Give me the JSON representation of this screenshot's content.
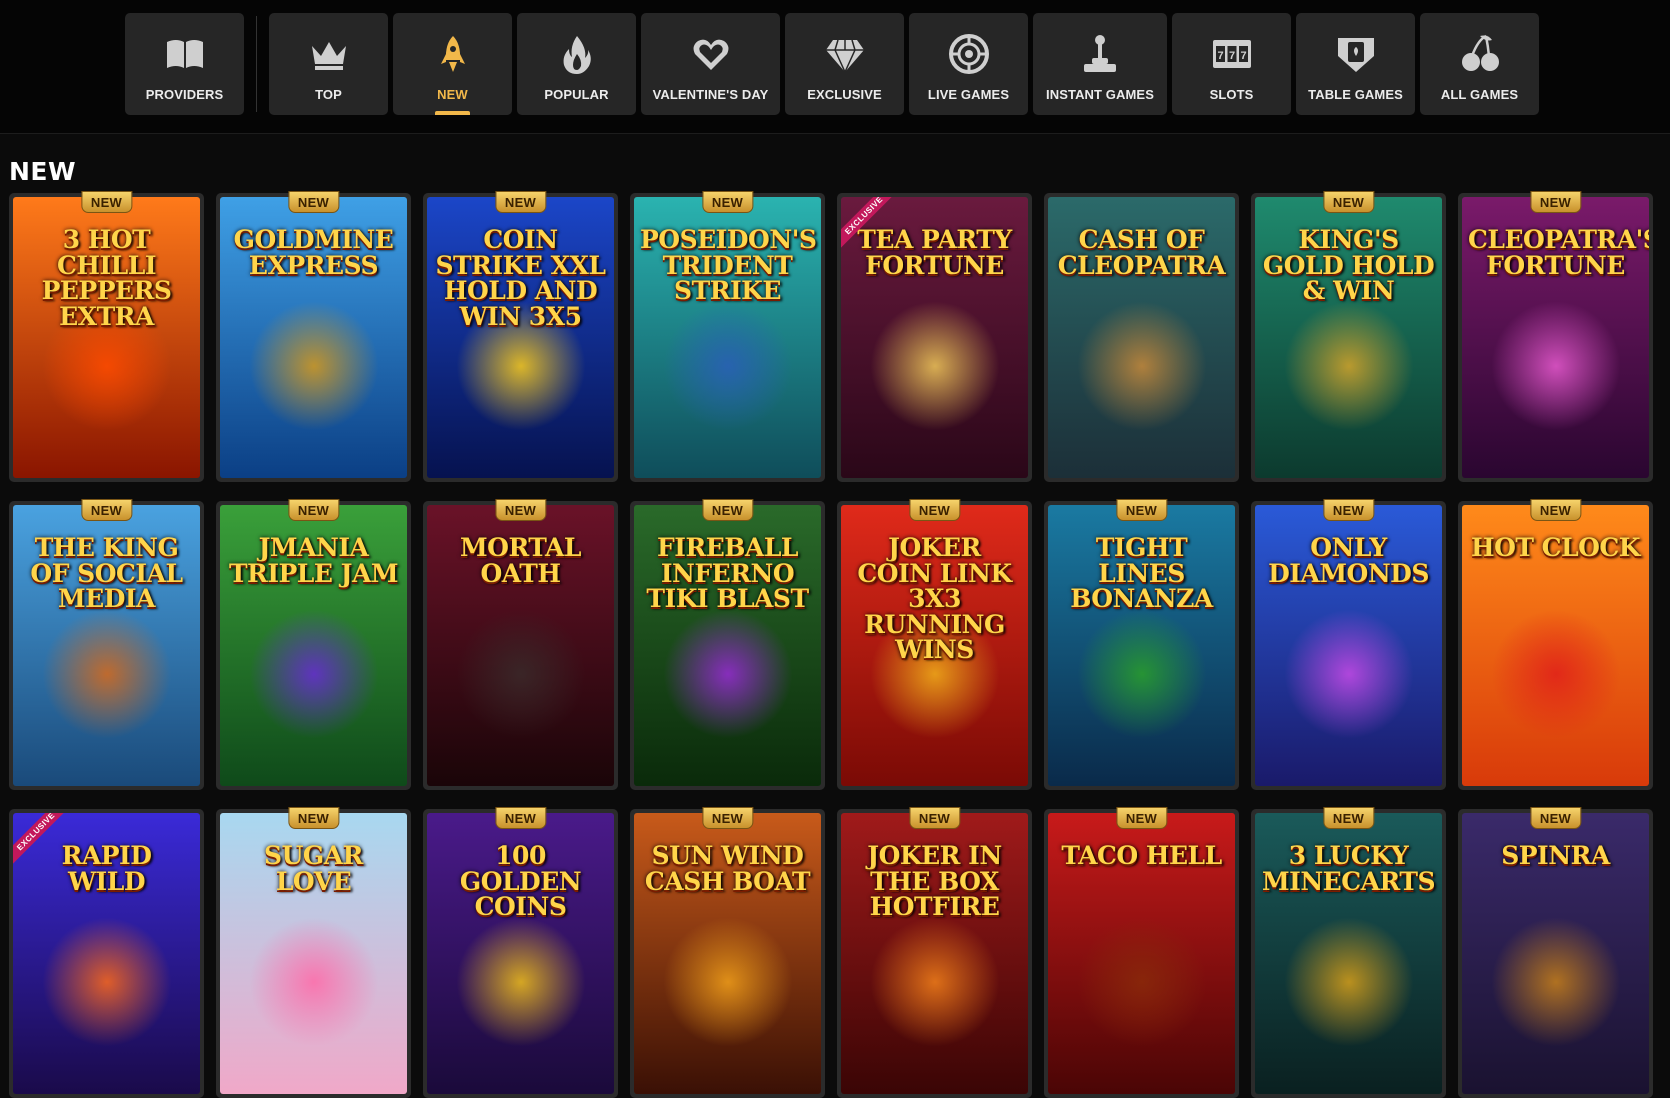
{
  "nav": {
    "items": [
      {
        "label": "PROVIDERS",
        "icon": "book-icon"
      },
      {
        "label": "TOP",
        "icon": "crown-icon"
      },
      {
        "label": "NEW",
        "icon": "rocket-icon",
        "active": true
      },
      {
        "label": "POPULAR",
        "icon": "fire-icon"
      },
      {
        "label": "VALENTINE'S DAY",
        "icon": "heart-icon"
      },
      {
        "label": "EXCLUSIVE",
        "icon": "diamond-icon"
      },
      {
        "label": "LIVE GAMES",
        "icon": "roulette-icon"
      },
      {
        "label": "INSTANT GAMES",
        "icon": "joystick-icon"
      },
      {
        "label": "SLOTS",
        "icon": "slot-machine-icon"
      },
      {
        "label": "TABLE GAMES",
        "icon": "card-table-icon"
      },
      {
        "label": "ALL GAMES",
        "icon": "cherries-icon"
      }
    ],
    "active_color": "#f2b84a"
  },
  "section": {
    "title": "NEW"
  },
  "badge_text": "NEW",
  "ribbon_text": "EXCLUSIVE",
  "games": [
    {
      "title": "3 HOT CHILLI PEPPERS EXTRA",
      "badge": true,
      "exclusive": false,
      "bg": [
        "#ff7a1a",
        "#8a1500"
      ],
      "glow": "#ff4b00"
    },
    {
      "title": "GOLDMINE EXPRESS",
      "badge": true,
      "exclusive": false,
      "bg": [
        "#3fa0e6",
        "#0b3f85"
      ],
      "glow": "#d89a1a"
    },
    {
      "title": "COIN STRIKE XXL HOLD AND WIN 3X5",
      "badge": true,
      "exclusive": false,
      "bg": [
        "#1b46c8",
        "#06124f"
      ],
      "glow": "#ffcf1a"
    },
    {
      "title": "POSEIDON'S TRIDENT STRIKE",
      "badge": true,
      "exclusive": false,
      "bg": [
        "#2ab3b0",
        "#0f4d5a"
      ],
      "glow": "#2a5fb8"
    },
    {
      "title": "TEA PARTY FORTUNE",
      "badge": false,
      "exclusive": true,
      "bg": [
        "#6a1a3e",
        "#2a0718"
      ],
      "glow": "#f2c95a"
    },
    {
      "title": "CASH OF CLEOPATRA",
      "badge": false,
      "exclusive": false,
      "bg": [
        "#2b6a6a",
        "#1c2f38"
      ],
      "glow": "#c88a3a"
    },
    {
      "title": "KING'S GOLD HOLD & WIN",
      "badge": true,
      "exclusive": false,
      "bg": [
        "#1f8a6e",
        "#0c3a2e"
      ],
      "glow": "#d6a52a"
    },
    {
      "title": "CLEOPATRA'S FORTUNE",
      "badge": true,
      "exclusive": false,
      "bg": [
        "#7a1a6a",
        "#2a0630"
      ],
      "glow": "#e85ad0"
    },
    {
      "title": "THE KING OF SOCIAL MEDIA",
      "badge": true,
      "exclusive": false,
      "bg": [
        "#4aa2e0",
        "#1a4a7a"
      ],
      "glow": "#d86a1a"
    },
    {
      "title": "JMANIA TRIPLE JAM",
      "badge": true,
      "exclusive": false,
      "bg": [
        "#3aa03a",
        "#0f4a1a"
      ],
      "glow": "#6a2ad8"
    },
    {
      "title": "MORTAL OATH",
      "badge": true,
      "exclusive": false,
      "bg": [
        "#6a1228",
        "#1a0508"
      ],
      "glow": "#3a2a2a"
    },
    {
      "title": "FIREBALL INFERNO TIKI BLAST",
      "badge": true,
      "exclusive": false,
      "bg": [
        "#2a6a2a",
        "#0a2a0a"
      ],
      "glow": "#9a2ad8"
    },
    {
      "title": "JOKER COIN LINK 3X3 RUNNING WINS",
      "badge": true,
      "exclusive": false,
      "bg": [
        "#e02a1a",
        "#7a0a05"
      ],
      "glow": "#f2b01a"
    },
    {
      "title": "TIGHT LINES BONANZA",
      "badge": true,
      "exclusive": false,
      "bg": [
        "#1a7aa2",
        "#0a2a4a"
      ],
      "glow": "#2aa02a"
    },
    {
      "title": "ONLY DIAMONDS",
      "badge": true,
      "exclusive": false,
      "bg": [
        "#2a5ad8",
        "#1a1a6a"
      ],
      "glow": "#c84ae8"
    },
    {
      "title": "HOT CLOCK",
      "badge": true,
      "exclusive": false,
      "bg": [
        "#ff8a1a",
        "#d83a0a"
      ],
      "glow": "#e0201a"
    },
    {
      "title": "RAPID WILD",
      "badge": false,
      "exclusive": true,
      "bg": [
        "#3a2ad8",
        "#1a0a4a"
      ],
      "glow": "#ff6a1a"
    },
    {
      "title": "SUGAR LOVE",
      "badge": true,
      "exclusive": false,
      "bg": [
        "#a8d8f0",
        "#f0a8c8"
      ],
      "glow": "#ff6aa8"
    },
    {
      "title": "100 GOLDEN COINS",
      "badge": true,
      "exclusive": false,
      "bg": [
        "#4a1a8a",
        "#1a0a3a"
      ],
      "glow": "#f2c01a"
    },
    {
      "title": "SUN WIND CASH BOAT",
      "badge": true,
      "exclusive": false,
      "bg": [
        "#c85a1a",
        "#3a1005"
      ],
      "glow": "#f2a01a"
    },
    {
      "title": "JOKER IN THE BOX HOTFIRE",
      "badge": true,
      "exclusive": false,
      "bg": [
        "#a01a1a",
        "#3a0505"
      ],
      "glow": "#f2801a"
    },
    {
      "title": "TACO HELL",
      "badge": true,
      "exclusive": false,
      "bg": [
        "#c81a1a",
        "#4a0505"
      ],
      "glow": "#8a2a0a"
    },
    {
      "title": "3 LUCKY MINECARTS",
      "badge": true,
      "exclusive": false,
      "bg": [
        "#1a5a5a",
        "#0a2020"
      ],
      "glow": "#d8a01a"
    },
    {
      "title": "SPINRA",
      "badge": true,
      "exclusive": false,
      "bg": [
        "#3a2a6a",
        "#1a1230"
      ],
      "glow": "#c8801a"
    }
  ]
}
